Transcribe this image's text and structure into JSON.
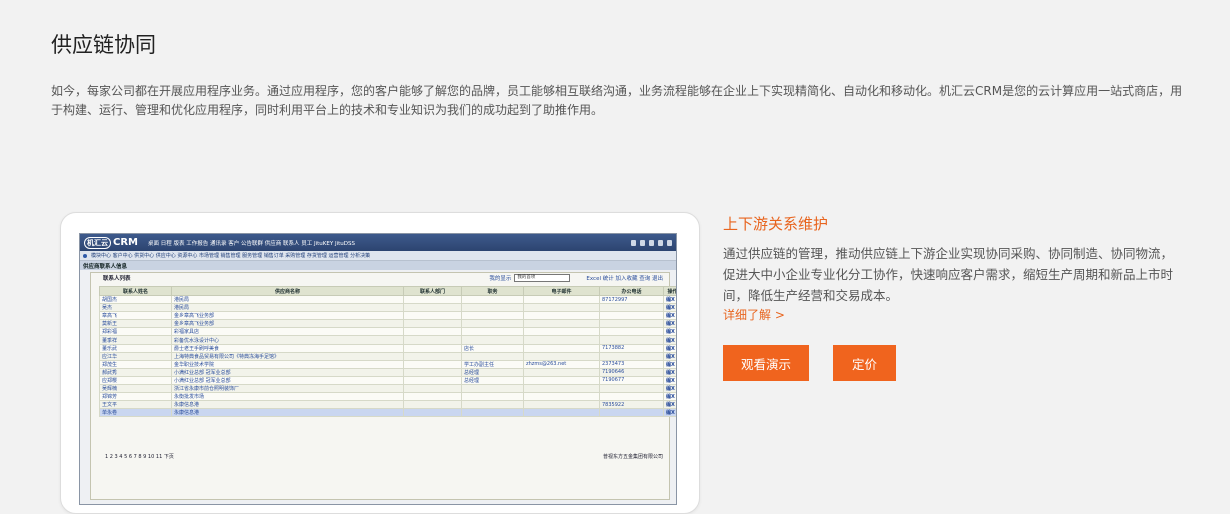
{
  "section": {
    "title": "供应链协同",
    "intro": "如今，每家公司都在开展应用程序业务。通过应用程序，您的客户能够了解您的品牌，员工能够相互联络沟通，业务流程能够在企业上下实现精简化、自动化和移动化。机汇云CRM是您的云计算应用一站式商店，用于构建、运行、管理和优化应用程序，同时利用平台上的技术和专业知识为我们的成功起到了助推作用。"
  },
  "feature": {
    "title": "上下游关系维护",
    "description": "通过供应链的管理，推动供应链上下游企业实现协同采购、协同制造、协同物流，促进大中小企业专业化分工协作，快速响应客户需求，缩短生产周期和新品上市时间，降低生产经营和交易成本。",
    "more_link": "详细了解 >",
    "demo_button": "观看演示",
    "price_button": "定价"
  },
  "app_shot": {
    "logo_cn": "机汇云",
    "logo_en": "CRM",
    "top_menu": "桌面 日程 版表 工作报告 通讯录 客户 公告联群 供应商 联系人 员工 JituKEY JituDSS",
    "sub_menu": "模块中心  客户中心  供货中心  供应中心  资源中心  市场管理  销售管理  服务管理  销售订单  采购管理  存货管理  运营管理  分析决策",
    "breadcrumb": "供应商联系人信息",
    "panel_title": "联系人列表",
    "select_label": "我的显示",
    "select_value": "我的首项",
    "panel_actions": "Excel 统计 加入收藏 查询 退出",
    "columns": [
      "联系人姓名",
      "供应商名称",
      "联系人部门",
      "职务",
      "电子邮件",
      "办公电话",
      "操作"
    ],
    "rows": [
      [
        "胡国杰",
        "港民局",
        "",
        "",
        "",
        "87172997",
        "编X"
      ],
      [
        "吴杰",
        "港民局",
        "",
        "",
        "",
        "",
        "编X"
      ],
      [
        "章高飞",
        "金乡章高飞业务部",
        "",
        "",
        "",
        "",
        "编X"
      ],
      [
        "莫新王",
        "金乡章高飞业务部",
        "",
        "",
        "",
        "",
        "编X"
      ],
      [
        "郑彩福",
        "彩福家具店",
        "",
        "",
        "",
        "",
        "编X"
      ],
      [
        "董季祥",
        "彩备优水泳设计中心",
        "",
        "",
        "",
        "",
        "编X"
      ],
      [
        "董乐武",
        "爵士老王手刷呼美食",
        "",
        "店长",
        "",
        "7173882",
        "编X"
      ],
      [
        "应江华",
        "上海特典食品贸易有限公司《特典冻海手足馆》",
        "",
        "",
        "",
        "",
        "编X"
      ],
      [
        "郑茂生",
        "金华职业技术学院",
        "",
        "学工办副主任",
        "zhzms@263.net",
        "2373473",
        "编X"
      ],
      [
        "郝武秀",
        "小满红业总部 冠军业总部",
        "",
        "总经理",
        "",
        "7190646",
        "编X"
      ],
      [
        "应郑樱",
        "小满红业总部 冠军业总部",
        "",
        "总经理",
        "",
        "7190677",
        "编X"
      ],
      [
        "吴辉楠",
        "浙江省永康市前仓照明装饰厂",
        "",
        "",
        "",
        "",
        "编X"
      ],
      [
        "郑锦芳",
        "永衡批发市场",
        "",
        "",
        "",
        "",
        "编X"
      ],
      [
        "王文平",
        "永康信息港",
        "",
        "",
        "",
        "7835922",
        "编X"
      ],
      [
        "单永卷",
        "永康信息港",
        "",
        "",
        "",
        "",
        "编X"
      ]
    ],
    "pagination": "1 2 3 4 5 6 7 8 9 10 11  下页",
    "company": "普视东方五金集团有限公司"
  },
  "colors": {
    "accent": "#f0641e",
    "accent_text": "#e8641e",
    "page_bg": "#f2f2f2"
  }
}
